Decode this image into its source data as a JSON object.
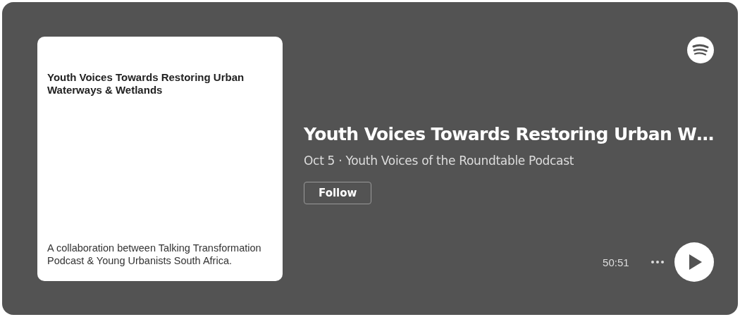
{
  "cover": {
    "title": "Youth Voices Towards Restoring Urban Waterways & Wetlands",
    "caption": "A collaboration between Talking Transformation Podcast & Young Urbanists South Africa."
  },
  "episode": {
    "title": "Youth Voices Towards Restoring Urban W…",
    "subtitle": "Oct 5 · Youth Voices of the Roundtable Podcast"
  },
  "follow_button": {
    "label": "Follow"
  },
  "duration": "50:51"
}
